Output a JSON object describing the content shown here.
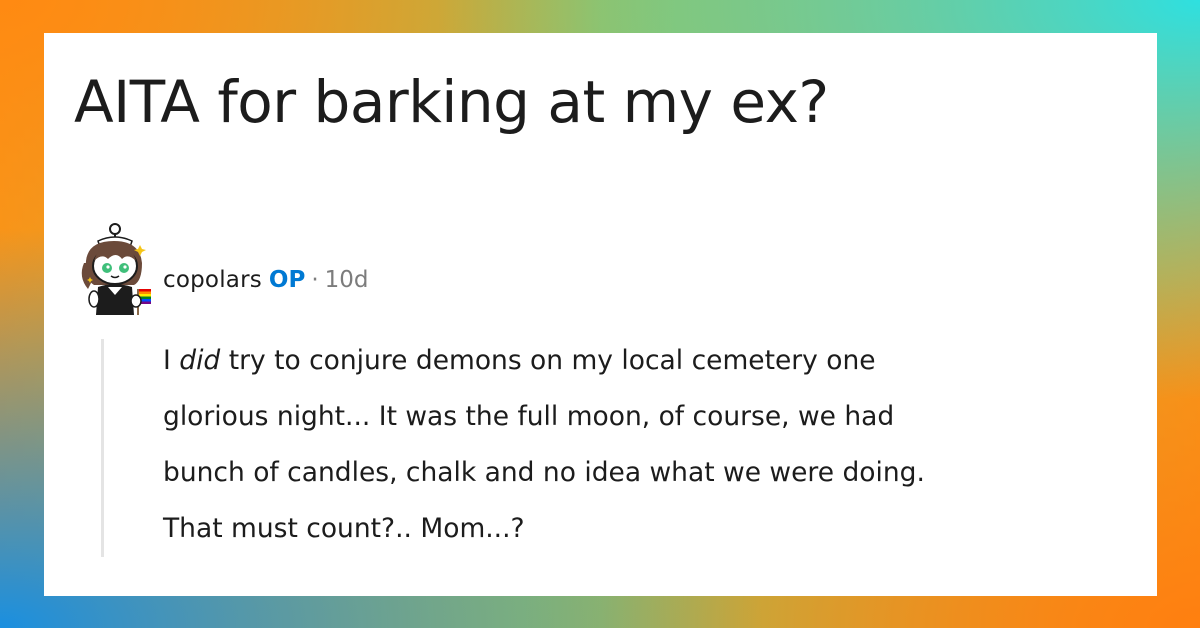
{
  "post": {
    "title": "AITA for barking at my ex?"
  },
  "comment": {
    "username": "copolars",
    "op_badge": "OP",
    "separator": "·",
    "age": "10d",
    "avatar_icon": "snoo-avatar-icon",
    "body": {
      "line1_pre": "I ",
      "line1_em": "did",
      "line1_post": " try to conjure demons on my local cemetery one",
      "line2": "glorious night... It was the full moon, of course, we had",
      "line3": "bunch of candles, chalk and no idea what we were doing.",
      "line4": "That must count?.. Mom...?"
    }
  },
  "colors": {
    "op_badge": "#0079d3",
    "meta_gray": "#7c7c7c",
    "text": "#1c1c1c",
    "card": "#ffffff"
  }
}
